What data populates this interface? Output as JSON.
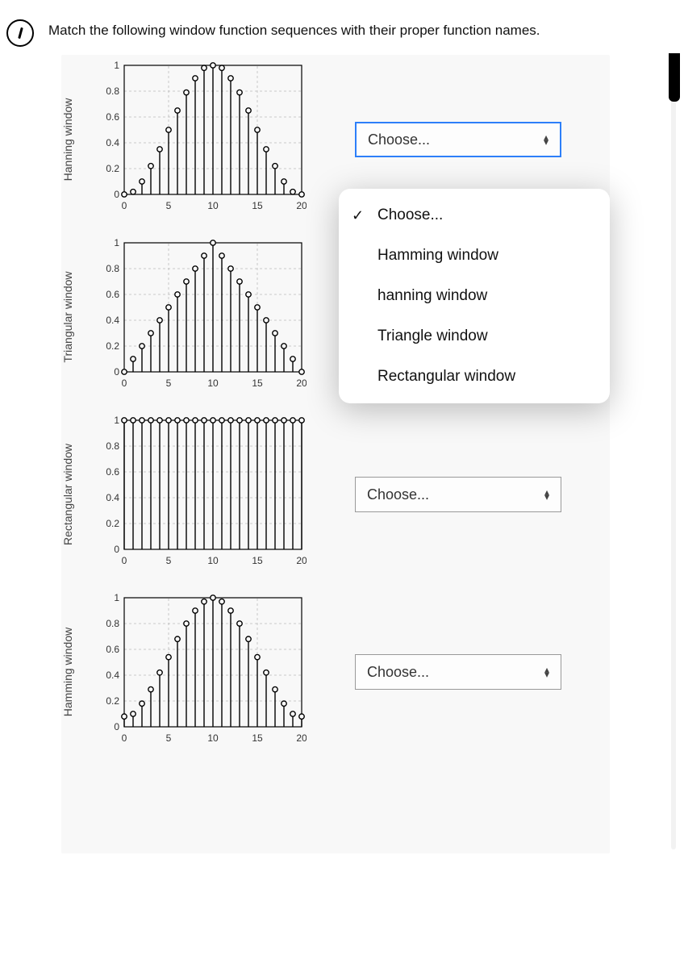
{
  "prompt": "Match the following window function sequences with their proper function names.",
  "dropdown": {
    "selected_label": "Choose...",
    "options": [
      "Choose...",
      "Hamming window",
      "hanning window",
      "Triangle window",
      "Rectangular window"
    ]
  },
  "selects": {
    "placeholder": "Choose..."
  },
  "charts": [
    {
      "ylabel": "Hanning window"
    },
    {
      "ylabel": "Triangular window"
    },
    {
      "ylabel": "Rectangular window"
    },
    {
      "ylabel": "Hamming window"
    }
  ],
  "chart_data": [
    {
      "type": "bar",
      "title": "",
      "xlabel": "",
      "ylabel": "Hanning window",
      "xlim": [
        0,
        20
      ],
      "ylim": [
        0,
        1
      ],
      "x": [
        0,
        1,
        2,
        3,
        4,
        5,
        6,
        7,
        8,
        9,
        10,
        11,
        12,
        13,
        14,
        15,
        16,
        17,
        18,
        19,
        20
      ],
      "values": [
        0.0,
        0.02,
        0.1,
        0.22,
        0.35,
        0.5,
        0.65,
        0.79,
        0.9,
        0.98,
        1.0,
        0.98,
        0.9,
        0.79,
        0.65,
        0.5,
        0.35,
        0.22,
        0.1,
        0.02,
        0.0
      ],
      "yticks": [
        0,
        0.2,
        0.4,
        0.6,
        0.8,
        1
      ],
      "xticks": [
        0,
        5,
        10,
        15,
        20
      ]
    },
    {
      "type": "bar",
      "title": "",
      "xlabel": "",
      "ylabel": "Triangular window",
      "xlim": [
        0,
        20
      ],
      "ylim": [
        0,
        1
      ],
      "x": [
        0,
        1,
        2,
        3,
        4,
        5,
        6,
        7,
        8,
        9,
        10,
        11,
        12,
        13,
        14,
        15,
        16,
        17,
        18,
        19,
        20
      ],
      "values": [
        0.0,
        0.1,
        0.2,
        0.3,
        0.4,
        0.5,
        0.6,
        0.7,
        0.8,
        0.9,
        1.0,
        0.9,
        0.8,
        0.7,
        0.6,
        0.5,
        0.4,
        0.3,
        0.2,
        0.1,
        0.0
      ],
      "yticks": [
        0,
        0.2,
        0.4,
        0.6,
        0.8,
        1
      ],
      "xticks": [
        0,
        5,
        10,
        15,
        20
      ]
    },
    {
      "type": "bar",
      "title": "",
      "xlabel": "",
      "ylabel": "Rectangular window",
      "xlim": [
        0,
        20
      ],
      "ylim": [
        0,
        1
      ],
      "x": [
        0,
        1,
        2,
        3,
        4,
        5,
        6,
        7,
        8,
        9,
        10,
        11,
        12,
        13,
        14,
        15,
        16,
        17,
        18,
        19,
        20
      ],
      "values": [
        1,
        1,
        1,
        1,
        1,
        1,
        1,
        1,
        1,
        1,
        1,
        1,
        1,
        1,
        1,
        1,
        1,
        1,
        1,
        1,
        1
      ],
      "yticks": [
        0,
        0.2,
        0.4,
        0.6,
        0.8,
        1
      ],
      "xticks": [
        0,
        5,
        10,
        15,
        20
      ]
    },
    {
      "type": "bar",
      "title": "",
      "xlabel": "",
      "ylabel": "Hamming window",
      "xlim": [
        0,
        20
      ],
      "ylim": [
        0,
        1
      ],
      "x": [
        0,
        1,
        2,
        3,
        4,
        5,
        6,
        7,
        8,
        9,
        10,
        11,
        12,
        13,
        14,
        15,
        16,
        17,
        18,
        19,
        20
      ],
      "values": [
        0.08,
        0.1,
        0.18,
        0.29,
        0.42,
        0.54,
        0.68,
        0.8,
        0.9,
        0.97,
        1.0,
        0.97,
        0.9,
        0.8,
        0.68,
        0.54,
        0.42,
        0.29,
        0.18,
        0.1,
        0.08
      ],
      "yticks": [
        0,
        0.2,
        0.4,
        0.6,
        0.8,
        1
      ],
      "xticks": [
        0,
        5,
        10,
        15,
        20
      ]
    }
  ]
}
